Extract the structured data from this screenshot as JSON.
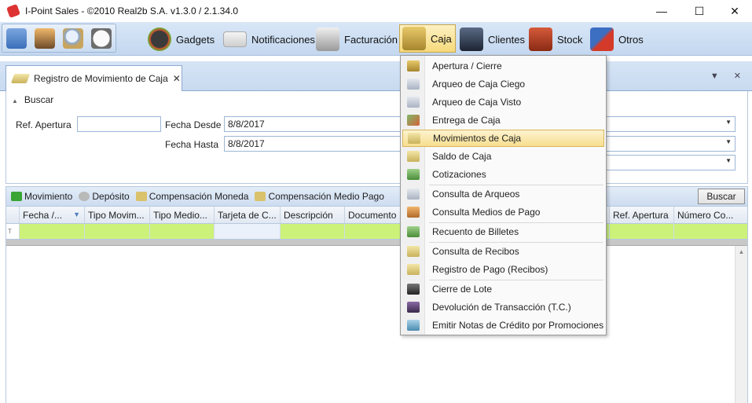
{
  "window": {
    "title": "I-Point Sales  - ©2010 Real2b S.A. v1.3.0 / 2.1.34.0",
    "minimize": "—",
    "maximize": "☐",
    "close": "✕"
  },
  "toolbar": {
    "quick_icons": [
      "home-icon",
      "user-icon",
      "search-icon",
      "clock-icon"
    ],
    "items": [
      {
        "label": "Gadgets",
        "icon": "gauge-icon"
      },
      {
        "label": "Notificaciones",
        "icon": "envelope-icon"
      },
      {
        "label": "Facturación",
        "icon": "cash-register-icon"
      },
      {
        "label": "Caja",
        "icon": "safe-icon"
      },
      {
        "label": "Clientes",
        "icon": "customer-icon"
      },
      {
        "label": "Stock",
        "icon": "boxes-icon"
      },
      {
        "label": "Otros",
        "icon": "tools-icon"
      }
    ]
  },
  "doc_tab": {
    "label": "Registro de Movimiento de Caja",
    "close": "✕"
  },
  "strip_controls": "▼ ✕",
  "form": {
    "section_label": "Buscar",
    "ref_apertura_label": "Ref. Apertura",
    "ref_apertura_value": "",
    "fecha_desde_label": "Fecha Desde",
    "fecha_desde_value": "8/8/2017",
    "fecha_hasta_label": "Fecha Hasta",
    "fecha_hasta_value": "8/8/2017"
  },
  "actions": [
    {
      "label": "Movimiento",
      "icon": "plus-icon",
      "color": "#3aa534"
    },
    {
      "label": "Depósito",
      "icon": "money-bag-icon",
      "color": "#b9b9b9"
    },
    {
      "label": "Compensación Moneda",
      "icon": "coins-icon",
      "color": "#d9c26b"
    },
    {
      "label": "Compensación Medio Pago",
      "icon": "coins-icon",
      "color": "#d9c26b"
    }
  ],
  "buscar_button": "Buscar",
  "grid": {
    "columns": [
      "Fecha /...",
      "Tipo Movim...",
      "Tipo Medio...",
      "Tarjeta de C...",
      "Descripción",
      "Documento",
      "",
      "",
      "",
      "Ref. Apertura",
      "Número Co..."
    ],
    "filter_marker": "T"
  },
  "menu": {
    "items": [
      {
        "label": "Apertura / Cierre",
        "icon": "safe-icon"
      },
      {
        "label": "Arqueo de Caja Ciego",
        "icon": "document-icon"
      },
      {
        "label": "Arqueo de Caja Visto",
        "icon": "document-icon"
      },
      {
        "label": "Entrega de Caja",
        "icon": "handover-icon"
      },
      {
        "label": "Movimientos de Caja",
        "icon": "banknote-icon"
      },
      {
        "label": "Saldo de Caja",
        "icon": "banknote-icon"
      },
      {
        "label": "Cotizaciones",
        "icon": "exchange-icon"
      },
      {
        "label": "Consulta de Arqueos",
        "icon": "document-icon"
      },
      {
        "label": "Consulta Medios de Pago",
        "icon": "payment-icon"
      },
      {
        "label": "Recuento de Billetes",
        "icon": "cash-count-icon"
      },
      {
        "label": "Consulta de Recibos",
        "icon": "banknote-icon"
      },
      {
        "label": "Registro de Pago (Recibos)",
        "icon": "banknote-icon"
      },
      {
        "label": "Cierre de Lote",
        "icon": "card-terminal-icon"
      },
      {
        "label": "Devolución de Transacción (T.C.)",
        "icon": "card-return-icon"
      },
      {
        "label": "Emitir Notas de Crédito por Promociones",
        "icon": "promo-note-icon"
      }
    ],
    "highlighted_index": 4
  }
}
